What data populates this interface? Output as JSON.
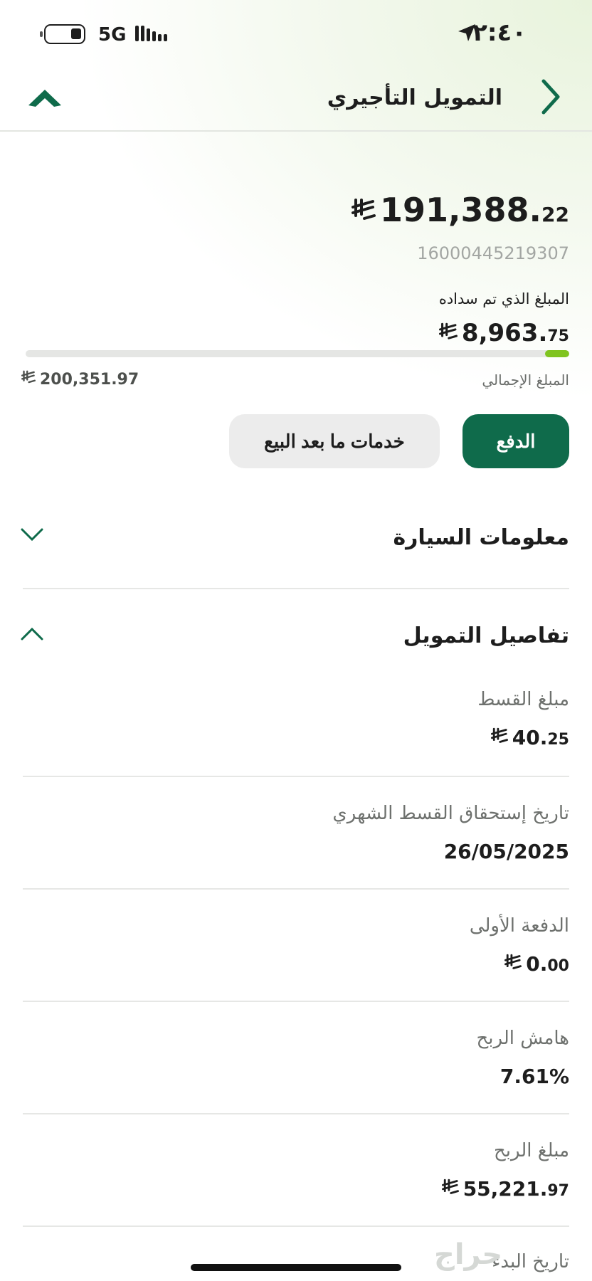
{
  "status_bar": {
    "network": "5G",
    "time": "٢:٤٠"
  },
  "header": {
    "title": "التمويل التأجيري"
  },
  "summary": {
    "balance_int": "191,388.",
    "balance_dec": "22",
    "account_number": "16000445219307",
    "paid_label": "المبلغ الذي تم سداده",
    "paid_int": "8,963.",
    "paid_dec": "75",
    "progress_fraction": 0.0447,
    "total_label": "المبلغ الإجمالي",
    "total_value": "200,351.97"
  },
  "actions": {
    "pay_label": "الدفع",
    "after_sales_label": "خدمات ما بعد البيع"
  },
  "sections": {
    "car_info": "معلومات السيارة",
    "financing_details": "تفاصيل التمويل"
  },
  "details": {
    "installment_label": "مبلغ القسط",
    "installment_int": "40.",
    "installment_dec": "25",
    "due_date_label": "تاريخ إستحقاق القسط الشهري",
    "due_date_value": "26/05/2025",
    "down_payment_label": "الدفعة الأولى",
    "down_payment_int": "0.",
    "down_payment_dec": "00",
    "profit_margin_label": "هامش الربح",
    "profit_margin_value": "7.61%",
    "profit_amount_label": "مبلغ الربح",
    "profit_amount_int": "55,221.",
    "profit_amount_dec": "97",
    "start_date_label": "تاريخ البدء"
  },
  "colors": {
    "primary": "#0f6b4b",
    "progress": "#7fc41f"
  },
  "watermark": "حراج"
}
